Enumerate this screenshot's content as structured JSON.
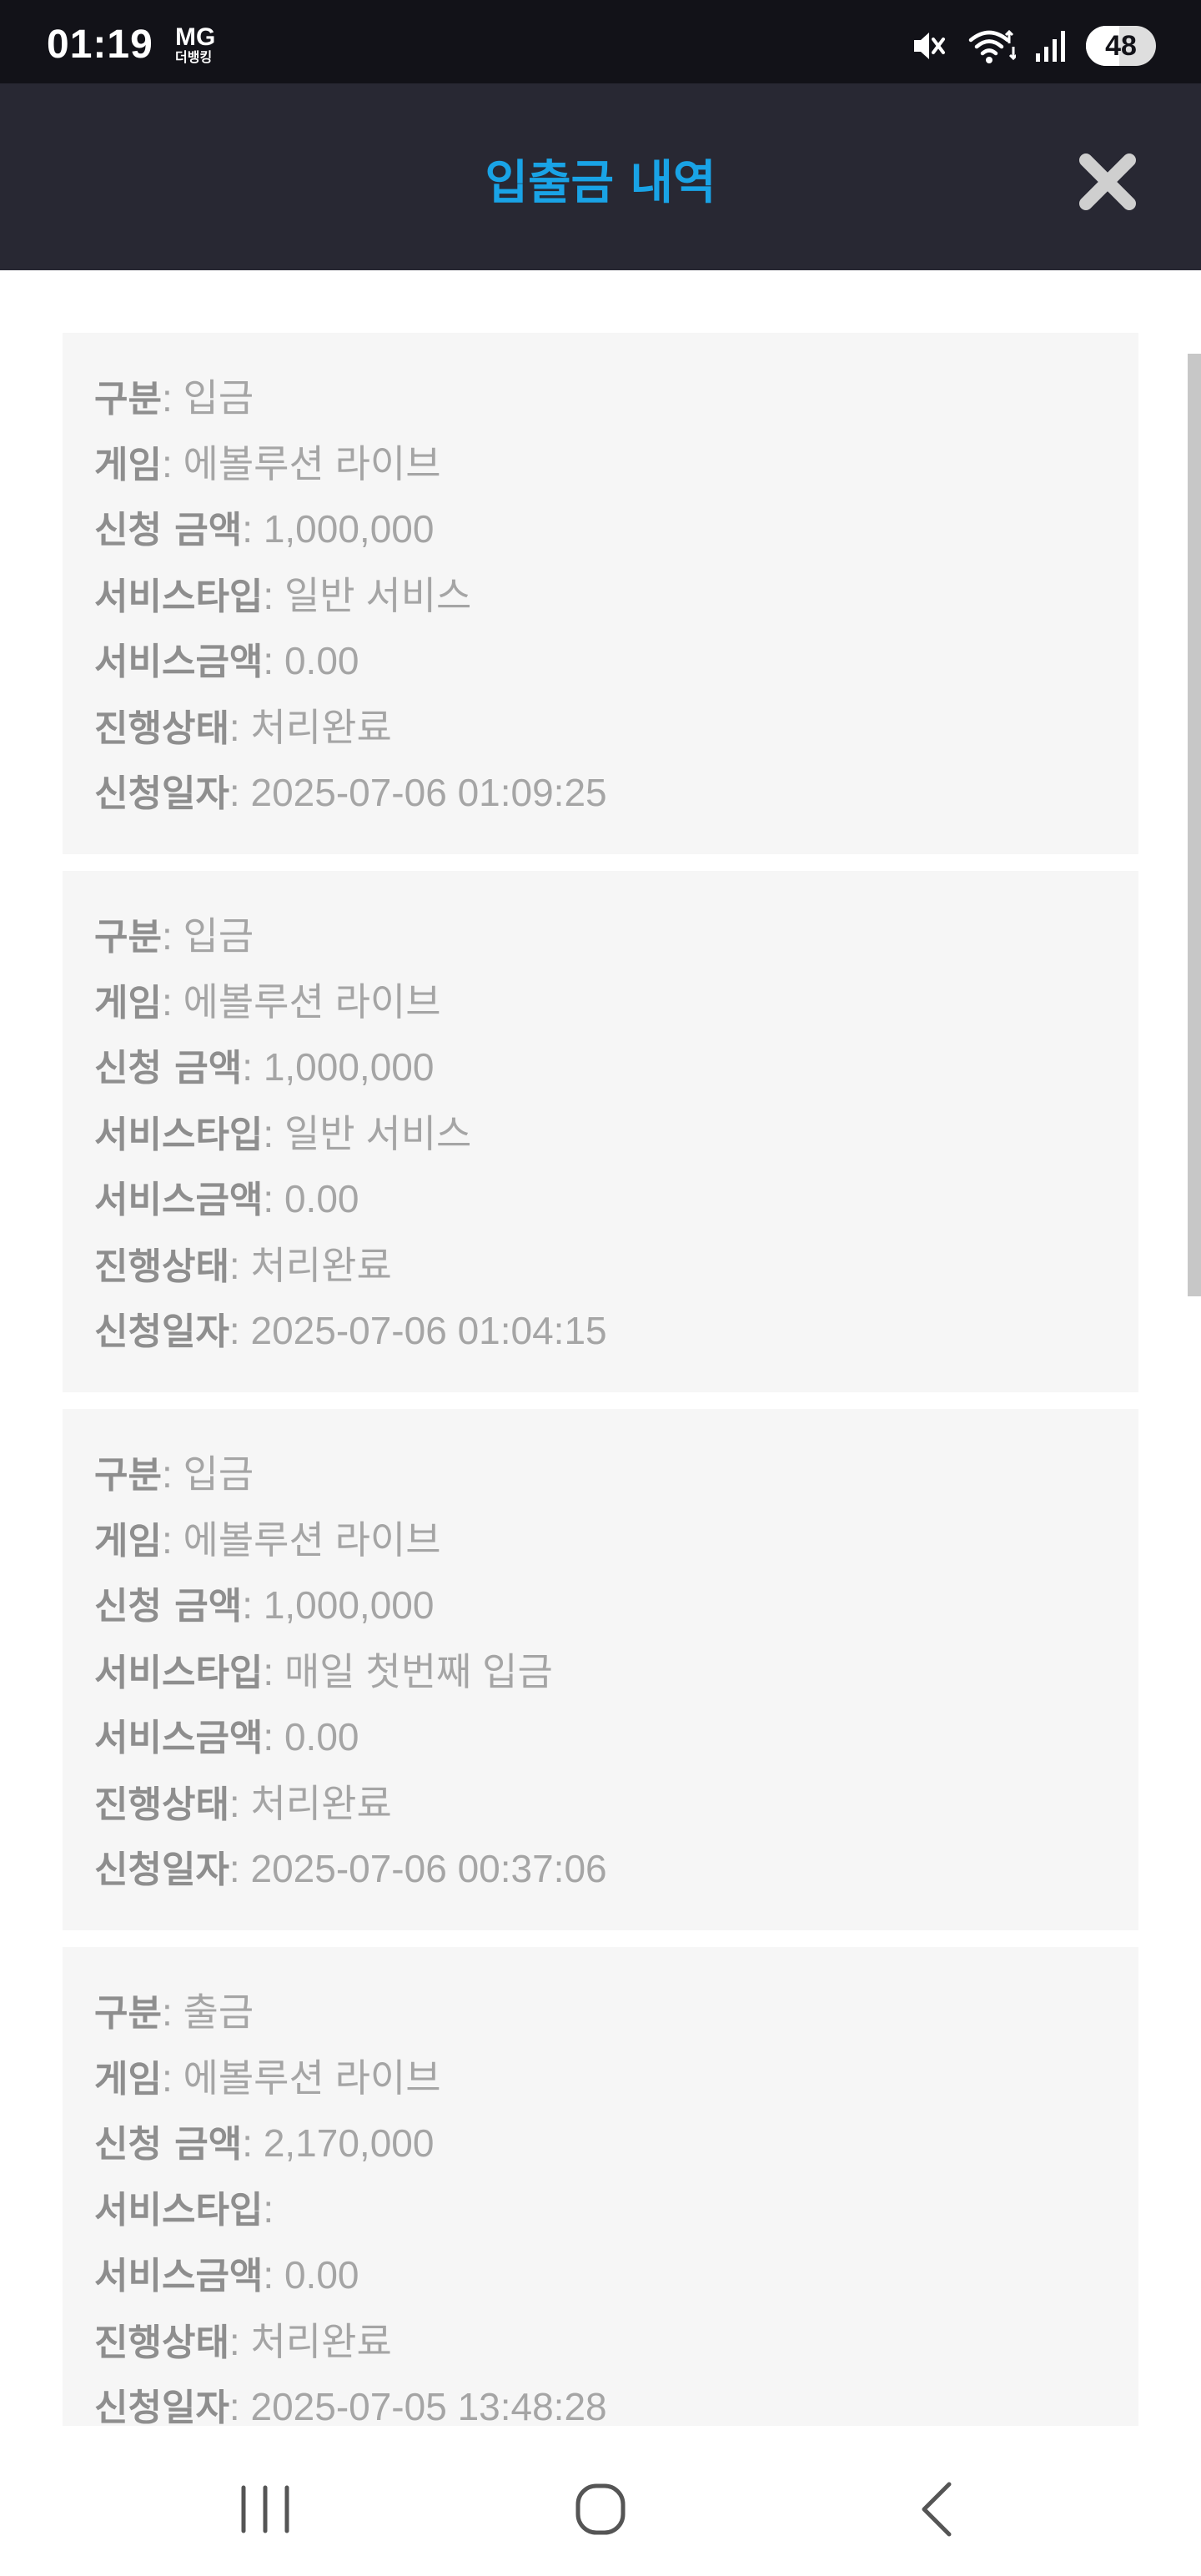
{
  "status_bar": {
    "time": "01:19",
    "carrier": "MG",
    "carrier_sub": "더뱅킹",
    "battery_level": "48",
    "icons": [
      "mute-icon",
      "wifi-icon",
      "signal-icon",
      "battery-icon"
    ]
  },
  "header": {
    "title": "입출금 내역",
    "close_icon": "close-icon"
  },
  "colors": {
    "title": "#19a3e6",
    "header_bg": "#282833",
    "card_bg": "#f6f6f6",
    "text": "#a5a5a5"
  },
  "labels": {
    "type": "구분",
    "game": "게임",
    "amount": "신청 금액",
    "service_type": "서비스타입",
    "service_amount": "서비스금액",
    "status": "진행상태",
    "date": "신청일자"
  },
  "transactions": [
    {
      "type": "입금",
      "game": "에볼루션 라이브",
      "amount": "1,000,000",
      "service_type": "일반 서비스",
      "service_amount": "0.00",
      "status": "처리완료",
      "date": "2025-07-06 01:09:25"
    },
    {
      "type": "입금",
      "game": "에볼루션 라이브",
      "amount": "1,000,000",
      "service_type": "일반 서비스",
      "service_amount": "0.00",
      "status": "처리완료",
      "date": "2025-07-06 01:04:15"
    },
    {
      "type": "입금",
      "game": "에볼루션 라이브",
      "amount": "1,000,000",
      "service_type": "매일 첫번째 입금",
      "service_amount": "0.00",
      "status": "처리완료",
      "date": "2025-07-06 00:37:06"
    },
    {
      "type": "출금",
      "game": "에볼루션 라이브",
      "amount": "2,170,000",
      "service_type": "",
      "service_amount": "0.00",
      "status": "처리완료",
      "date": "2025-07-05 13:48:28"
    }
  ],
  "nav_bar": {
    "recents_icon": "recents-icon",
    "home_icon": "home-icon",
    "back_icon": "back-icon"
  }
}
